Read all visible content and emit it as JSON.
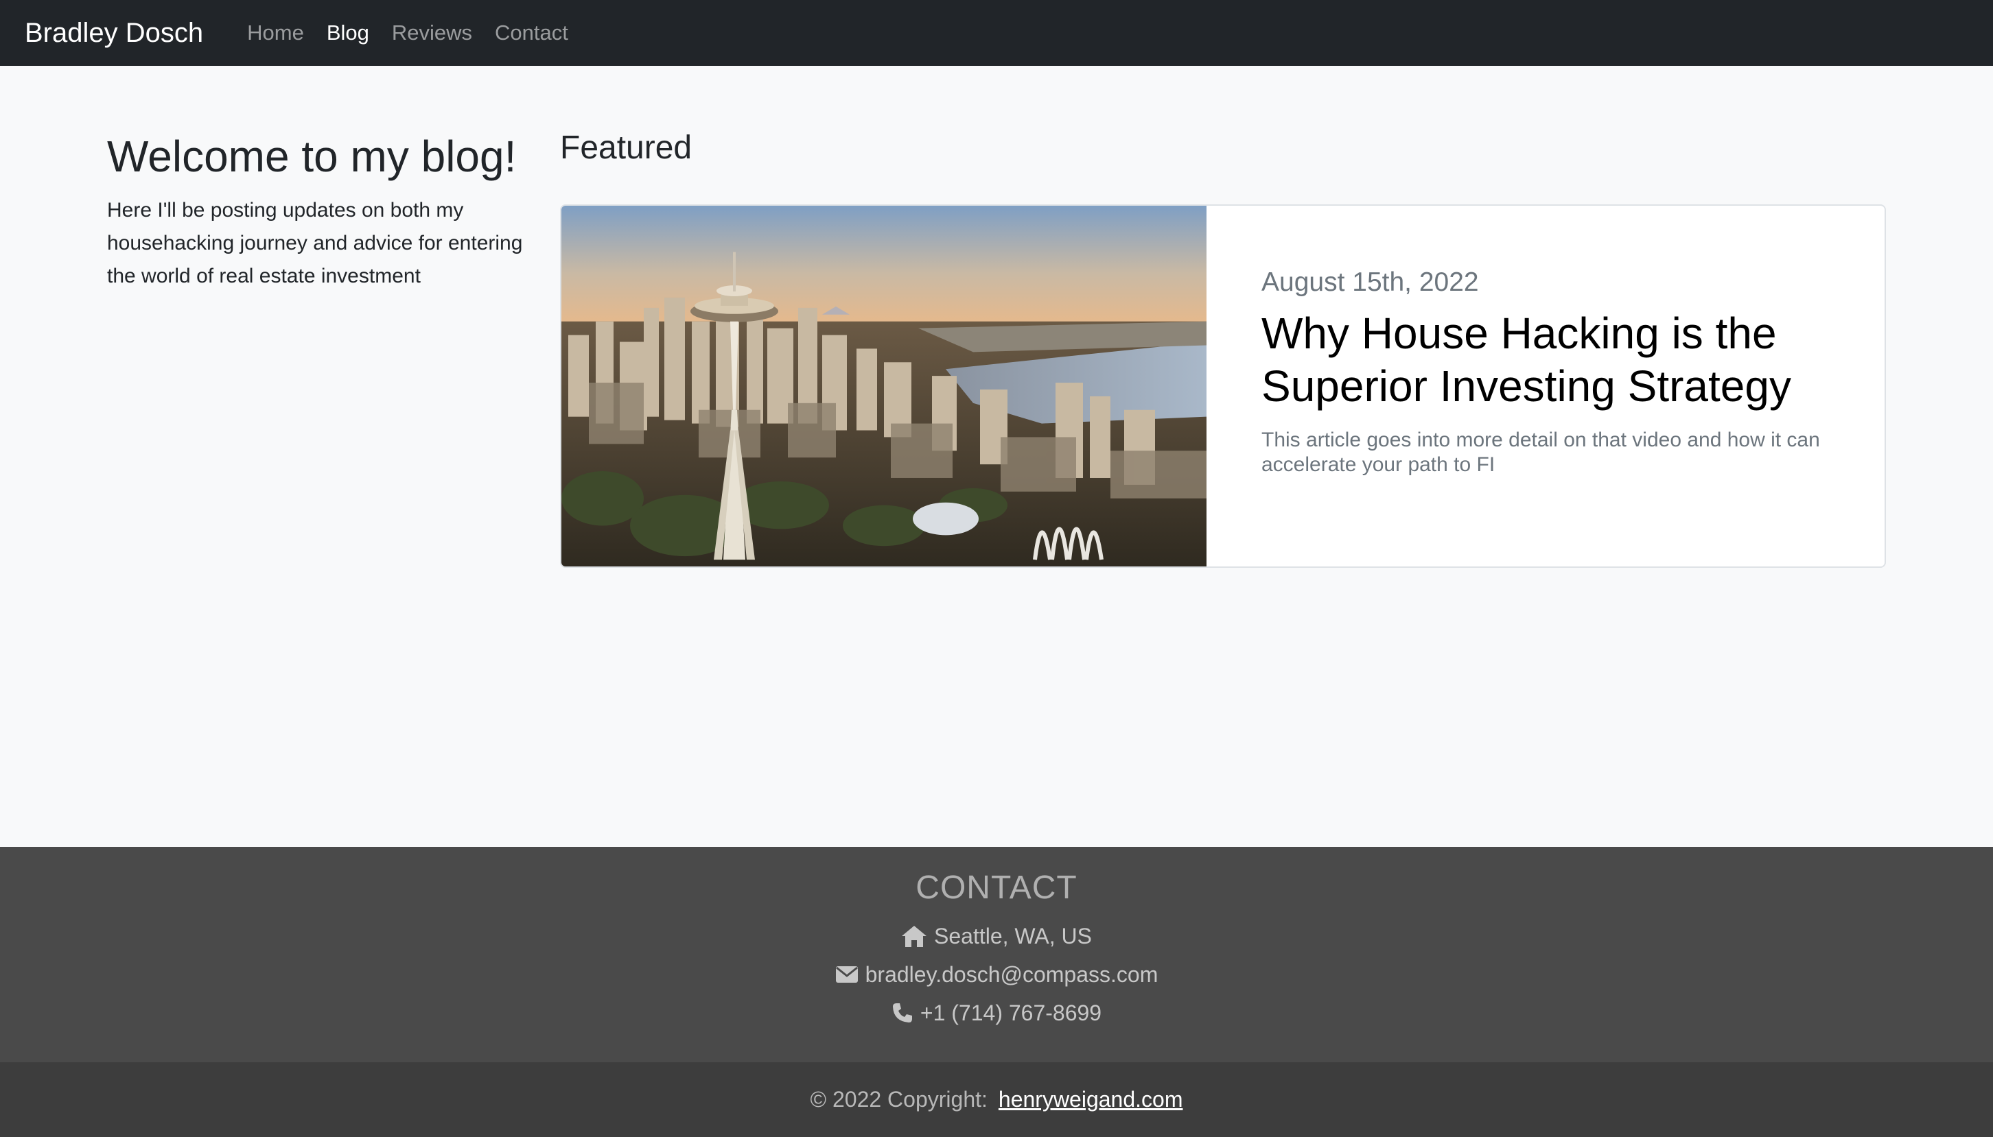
{
  "navbar": {
    "brand": "Bradley Dosch",
    "links": [
      {
        "label": "Home",
        "active": false
      },
      {
        "label": "Blog",
        "active": true
      },
      {
        "label": "Reviews",
        "active": false
      },
      {
        "label": "Contact",
        "active": false
      }
    ]
  },
  "intro": {
    "heading": "Welcome to my blog!",
    "text": "Here I'll be posting updates on both my househacking journey and advice for entering the world of real estate investment"
  },
  "featured": {
    "section_title": "Featured",
    "post": {
      "image_icon": "seattle-space-needle-photo",
      "date": "August 15th, 2022",
      "title": "Why House Hacking is the Superior Investing Strategy",
      "excerpt": "This article goes into more detail on that video and how it can accelerate your path to FI"
    }
  },
  "footer": {
    "heading": "CONTACT",
    "location": {
      "icon": "home-icon",
      "text": "Seattle, WA, US"
    },
    "email": {
      "icon": "envelope-icon",
      "text": "bradley.dosch@compass.com"
    },
    "phone": {
      "icon": "phone-icon",
      "text": "+1 (714) 767-8699"
    },
    "copyright_prefix": "© 2022 Copyright:",
    "copyright_link": "henryweigand.com"
  },
  "colors": {
    "navbar_bg": "#212529",
    "page_bg": "#f8f9fa",
    "footer_bg": "#4a4a4a",
    "copyright_bg": "#3d3d3d"
  }
}
